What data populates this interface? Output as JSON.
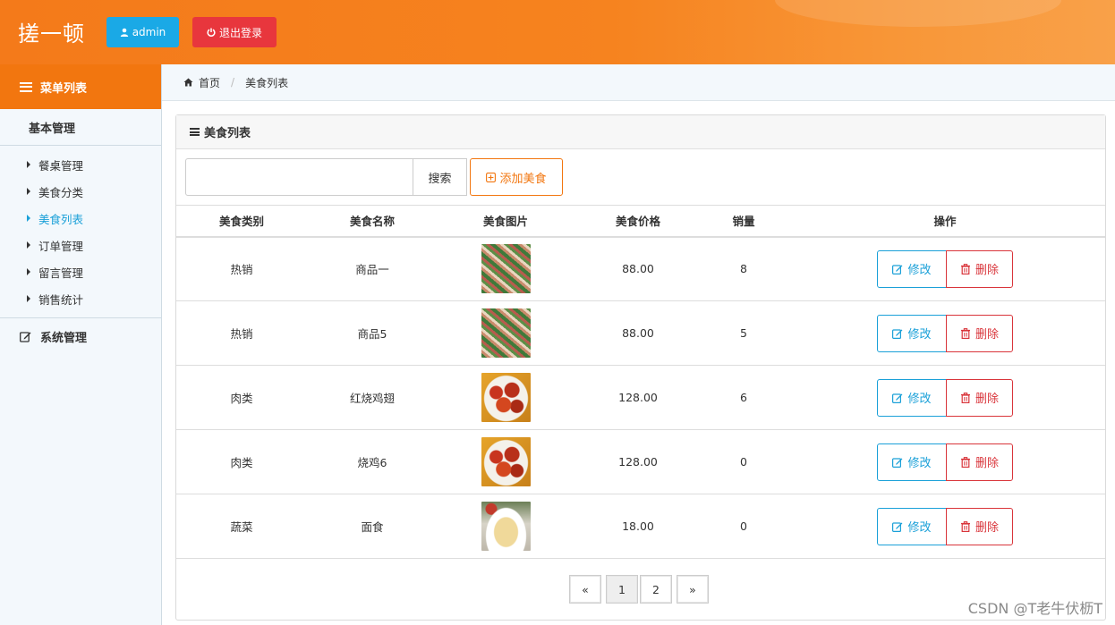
{
  "header": {
    "brand": "搓一顿",
    "admin_label": "admin",
    "logout_label": "退出登录"
  },
  "sidebar": {
    "title": "菜单列表",
    "group": "基本管理",
    "items": [
      {
        "label": "餐桌管理",
        "active": false
      },
      {
        "label": "美食分类",
        "active": false
      },
      {
        "label": "美食列表",
        "active": true
      },
      {
        "label": "订单管理",
        "active": false
      },
      {
        "label": "留言管理",
        "active": false
      },
      {
        "label": "销售统计",
        "active": false
      }
    ],
    "system_label": "系统管理"
  },
  "breadcrumb": {
    "home": "首页",
    "current": "美食列表"
  },
  "panel": {
    "title": "美食列表",
    "search_placeholder": "",
    "search_label": "搜索",
    "add_label": "添加美食"
  },
  "table": {
    "headers": [
      "美食类别",
      "美食名称",
      "美食图片",
      "美食价格",
      "销量",
      "操作"
    ],
    "rows": [
      {
        "category": "热销",
        "name": "商品一",
        "image": "vegetable-stirfry",
        "price": "88.00",
        "sales": "8"
      },
      {
        "category": "热销",
        "name": "商品5",
        "image": "vegetable-stirfry",
        "price": "88.00",
        "sales": "5"
      },
      {
        "category": "肉类",
        "name": "红烧鸡翅",
        "image": "braised-chicken-wings",
        "price": "128.00",
        "sales": "6"
      },
      {
        "category": "肉类",
        "name": "烧鸡6",
        "image": "braised-chicken-wings",
        "price": "128.00",
        "sales": "0"
      },
      {
        "category": "蔬菜",
        "name": "面食",
        "image": "pastry-dish",
        "price": "18.00",
        "sales": "0"
      }
    ],
    "edit_label": "修改",
    "delete_label": "删除"
  },
  "pagination": {
    "prev": "«",
    "pages": [
      "1",
      "2"
    ],
    "current": "1",
    "next": "»"
  },
  "watermark": "CSDN @T老牛伏枥T",
  "colors": {
    "header": "#f47a1a",
    "accent_blue": "#1aa0d8",
    "danger": "#d9343a",
    "admin_button": "#1aa9e6",
    "logout_button": "#e8363d"
  }
}
